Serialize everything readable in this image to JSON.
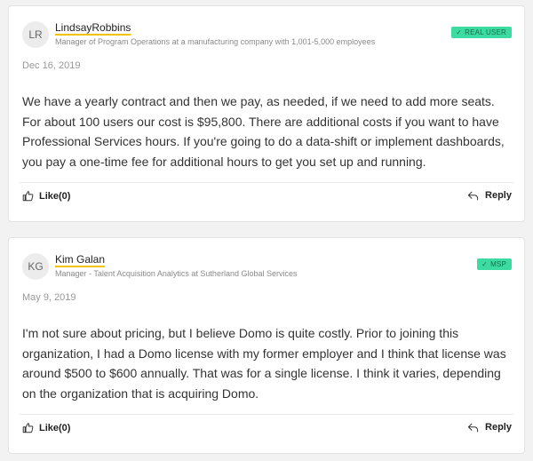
{
  "reviews": [
    {
      "initials": "LR",
      "name": "LindsayRobbins",
      "role": "Manager of Program Operations at a manufacturing company with 1,001-5,000 employees",
      "badge": "REAL USER",
      "date": "Dec 16, 2019",
      "text": "We have a yearly contract and then we pay, as needed, if we need to add more seats. For about 100 users our cost is $95,800. There are additional costs if you want to have Professional Services hours. If you're going to do a data-shift or implement dashboards, you pay a one-time fee for additional hours to get you set up and running.",
      "like_label": "Like(0)",
      "reply_label": "Reply"
    },
    {
      "initials": "KG",
      "name": "Kim Galan",
      "role": "Manager - Talent Acquisition Analytics at Sutherland Global Services",
      "badge": "MSP",
      "date": "May 9, 2019",
      "text": "I'm not sure about pricing, but I believe Domo is quite costly. Prior to joining this organization, I had a Domo license with my former employer and I think that license was around $500 to $600 annually. That was for a single license. I think it varies, depending on the organization that is acquiring Domo.",
      "like_label": "Like(0)",
      "reply_label": "Reply"
    }
  ],
  "icons": {
    "like": "thumbs-up-icon",
    "reply": "reply-icon",
    "badge_check": "check-icon"
  },
  "colors": {
    "badge_bg": "#3cdba2",
    "name_underline": "#f2c400"
  }
}
